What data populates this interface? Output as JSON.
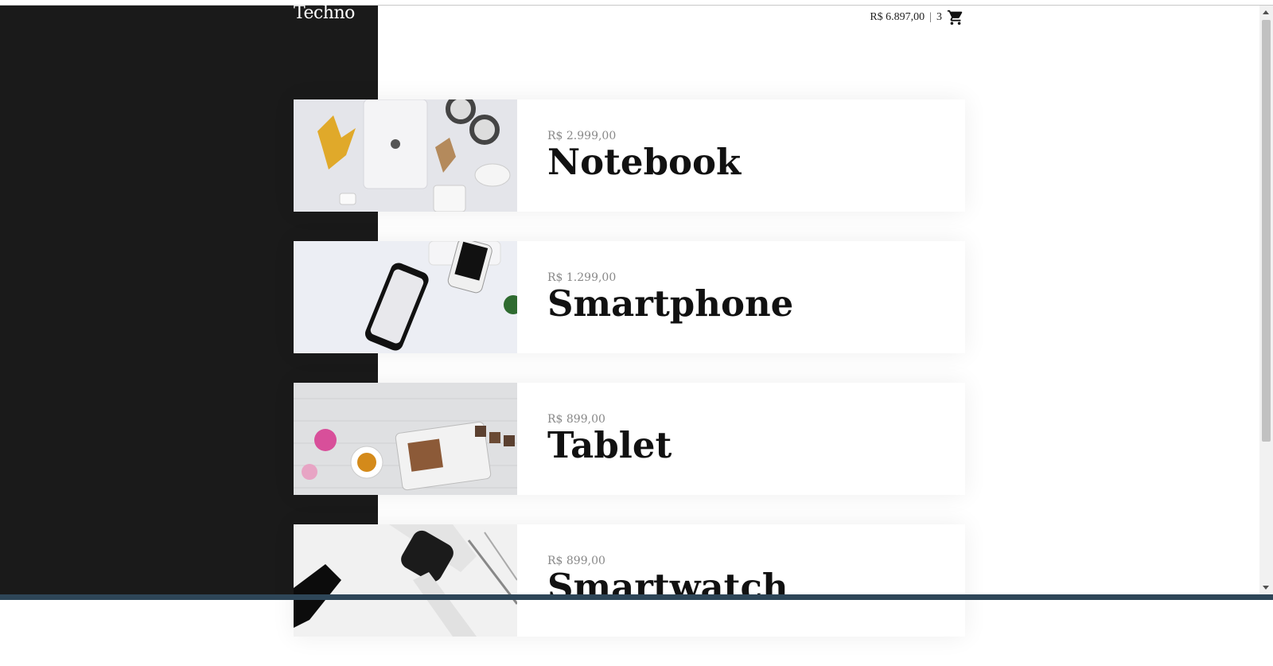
{
  "header": {
    "logo": "Techno",
    "cart_total": "R$ 6.897,00",
    "cart_separator": "|",
    "cart_count": "3",
    "cart_icon": "shopping-cart-icon"
  },
  "products": [
    {
      "price": "R$ 2.999,00",
      "name": "Notebook"
    },
    {
      "price": "R$ 1.299,00",
      "name": "Smartphone"
    },
    {
      "price": "R$ 899,00",
      "name": "Tablet"
    },
    {
      "price": "R$ 899,00",
      "name": "Smartwatch"
    }
  ],
  "colors": {
    "dark_panel": "#1a1a1a",
    "price_text": "#888888",
    "name_text": "#111111"
  }
}
